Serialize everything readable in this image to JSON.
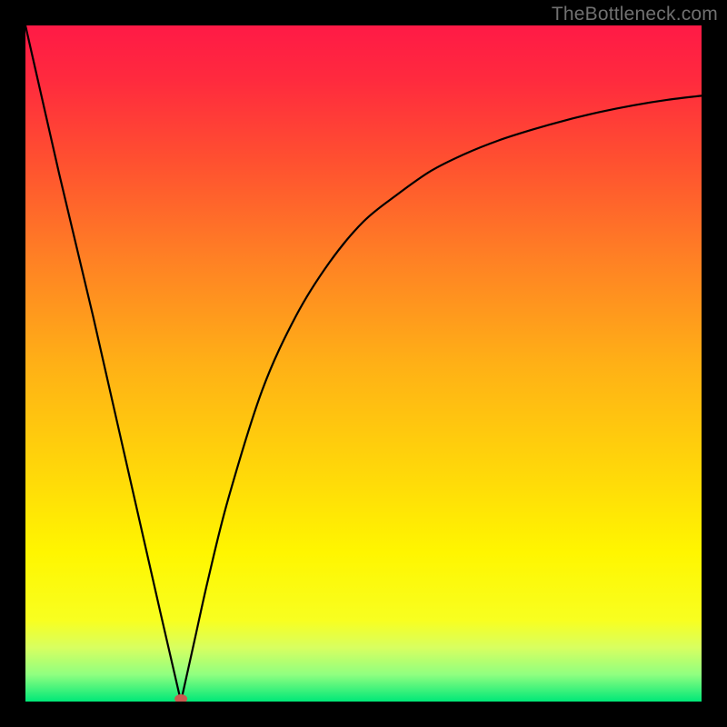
{
  "watermark": {
    "text": "TheBottleneck.com"
  },
  "colors": {
    "gradient_stops": [
      {
        "offset": 0.0,
        "color": "#ff1a46"
      },
      {
        "offset": 0.08,
        "color": "#ff2a3e"
      },
      {
        "offset": 0.2,
        "color": "#ff5030"
      },
      {
        "offset": 0.35,
        "color": "#ff8224"
      },
      {
        "offset": 0.5,
        "color": "#ffb016"
      },
      {
        "offset": 0.65,
        "color": "#ffd50a"
      },
      {
        "offset": 0.78,
        "color": "#fff600"
      },
      {
        "offset": 0.88,
        "color": "#f8ff20"
      },
      {
        "offset": 0.92,
        "color": "#d8ff60"
      },
      {
        "offset": 0.96,
        "color": "#90ff80"
      },
      {
        "offset": 1.0,
        "color": "#00e878"
      }
    ],
    "curve": "#000000",
    "marker_fill": "#c95b50",
    "background": "#000000"
  },
  "chart_data": {
    "type": "line",
    "title": "",
    "xlabel": "",
    "ylabel": "",
    "xlim": [
      0,
      100
    ],
    "ylim": [
      0,
      100
    ],
    "min_point": {
      "x": 23,
      "y": 0
    },
    "series": [
      {
        "name": "bottleneck-curve",
        "x": [
          0,
          5,
          10,
          15,
          20,
          23,
          25,
          27,
          30,
          35,
          40,
          45,
          50,
          55,
          60,
          65,
          70,
          75,
          80,
          85,
          90,
          95,
          100
        ],
        "y": [
          100,
          78,
          57,
          35,
          13,
          0,
          9,
          18,
          30,
          46,
          57,
          65,
          71,
          75,
          78.5,
          81,
          83,
          84.6,
          86,
          87.2,
          88.2,
          89,
          89.6
        ]
      }
    ],
    "marker": {
      "x": 23,
      "y": 0,
      "rx": 7,
      "ry": 5
    }
  }
}
